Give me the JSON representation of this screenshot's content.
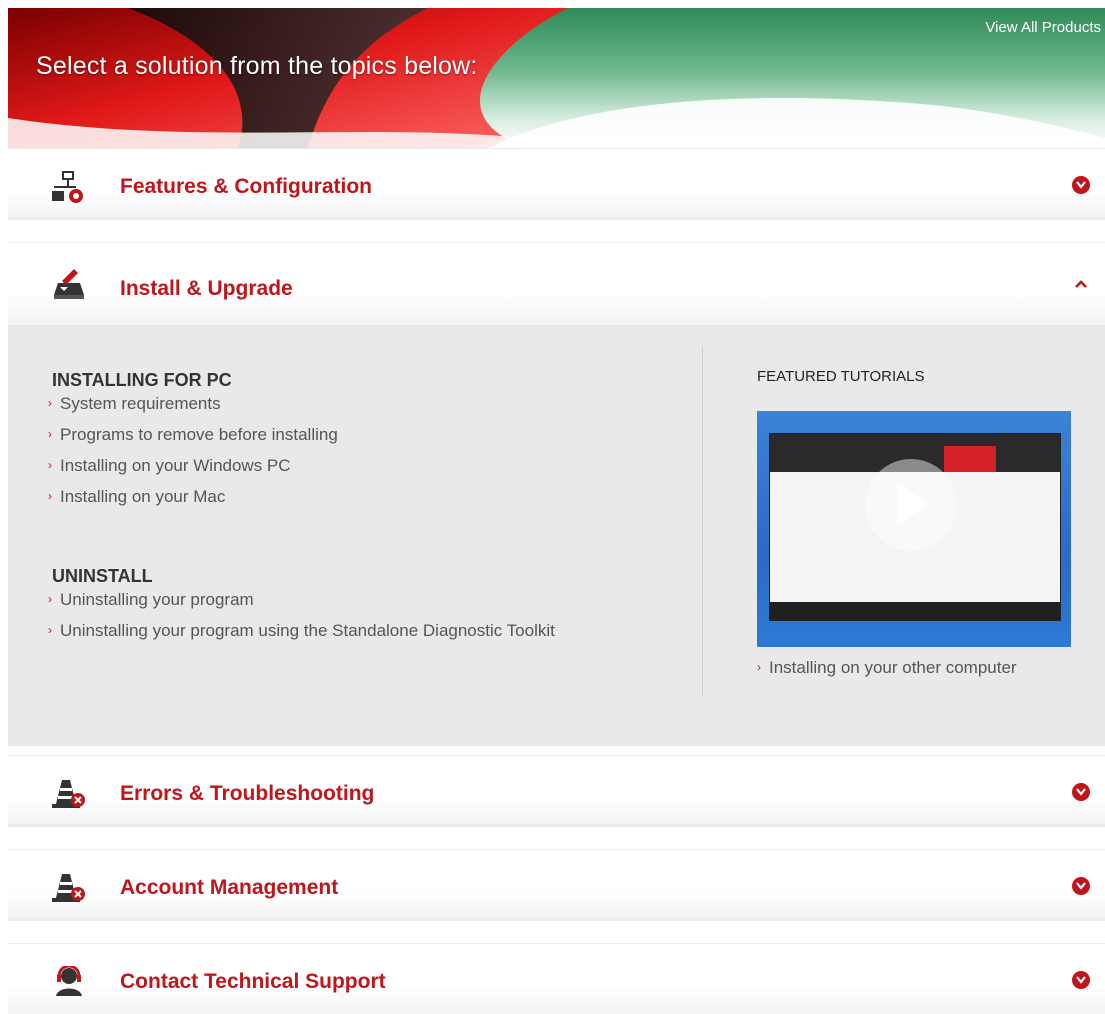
{
  "banner": {
    "title": "Select a solution from the topics below:",
    "view_all": "View All Products"
  },
  "sections": [
    {
      "title": "Features & Configuration",
      "icon": "network-gear-icon",
      "expanded": false
    },
    {
      "title": "Install & Upgrade",
      "icon": "install-tray-icon",
      "expanded": true
    },
    {
      "title": "Errors & Troubleshooting",
      "icon": "warning-cone-icon",
      "expanded": false
    },
    {
      "title": "Account Management",
      "icon": "account-cone-icon",
      "expanded": false
    },
    {
      "title": "Contact Technical Support",
      "icon": "support-headset-icon",
      "expanded": false
    }
  ],
  "install_panel": {
    "installing_heading": "INSTALLING FOR PC",
    "installing_links": [
      "System requirements",
      "Programs to remove before installing",
      "Installing on your Windows PC",
      "Installing on your Mac"
    ],
    "uninstall_heading": "UNINSTALL",
    "uninstall_links": [
      "Uninstalling your program",
      "Uninstalling your program using the Standalone Diagnostic Toolkit"
    ],
    "featured_heading": "FEATURED TUTORIALS",
    "featured_link": "Installing on your other computer"
  },
  "colors": {
    "accent_red": "#c0151b",
    "panel_bg": "#e9e9e9"
  }
}
